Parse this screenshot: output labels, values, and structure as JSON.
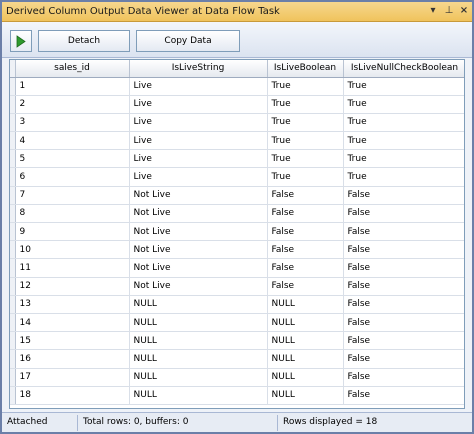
{
  "window": {
    "title": "Derived Column Output Data Viewer at Data Flow Task",
    "pin_icon": "▾",
    "pinned_icon": "⊥",
    "close_icon": "×"
  },
  "toolbar": {
    "detach_label": "Detach",
    "copy_label": "Copy Data",
    "play_color": "#2e9b2e"
  },
  "grid": {
    "columns": [
      "sales_id",
      "IsLiveString",
      "IsLiveBoolean",
      "IsLiveNullCheckBoolean"
    ],
    "rows": [
      [
        "1",
        "Live",
        "True",
        "True"
      ],
      [
        "2",
        "Live",
        "True",
        "True"
      ],
      [
        "3",
        "Live",
        "True",
        "True"
      ],
      [
        "4",
        "Live",
        "True",
        "True"
      ],
      [
        "5",
        "Live",
        "True",
        "True"
      ],
      [
        "6",
        "Live",
        "True",
        "True"
      ],
      [
        "7",
        "Not Live",
        "False",
        "False"
      ],
      [
        "8",
        "Not Live",
        "False",
        "False"
      ],
      [
        "9",
        "Not Live",
        "False",
        "False"
      ],
      [
        "10",
        "Not Live",
        "False",
        "False"
      ],
      [
        "11",
        "Not Live",
        "False",
        "False"
      ],
      [
        "12",
        "Not Live",
        "False",
        "False"
      ],
      [
        "13",
        "NULL",
        "NULL",
        "False"
      ],
      [
        "14",
        "NULL",
        "NULL",
        "False"
      ],
      [
        "15",
        "NULL",
        "NULL",
        "False"
      ],
      [
        "16",
        "NULL",
        "NULL",
        "False"
      ],
      [
        "17",
        "NULL",
        "NULL",
        "False"
      ],
      [
        "18",
        "NULL",
        "NULL",
        "False"
      ]
    ]
  },
  "status": {
    "state": "Attached",
    "totals": "Total rows: 0, buffers: 0",
    "displayed": "Rows displayed = 18"
  }
}
